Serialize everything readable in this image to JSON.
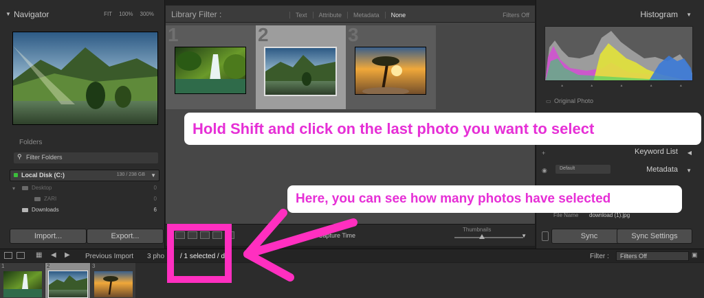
{
  "navigator": {
    "title": "Navigator",
    "zooms": [
      "FIT",
      "100%",
      "300%"
    ]
  },
  "folders": {
    "header_partial": "Folders",
    "filter_placeholder": "Filter Folders",
    "disk_label": "Local Disk (C:)",
    "disk_size": "130 / 238 GB",
    "tree": [
      {
        "label": "Desktop",
        "count": "0"
      },
      {
        "label": "ZARI",
        "count": "0"
      },
      {
        "label": "Downloads",
        "count": "6"
      }
    ],
    "import_label": "Import...",
    "export_label": "Export..."
  },
  "library_filter": {
    "title": "Library Filter :",
    "options": [
      "Text",
      "Attribute",
      "Metadata",
      "None"
    ],
    "active": "None",
    "filters_status": "Filters Off"
  },
  "grid": {
    "cells": [
      {
        "number": "1",
        "selected": false
      },
      {
        "number": "2",
        "selected": true
      },
      {
        "number": "3",
        "selected": false
      }
    ]
  },
  "toolbar": {
    "sort_label": "Capture Time",
    "thumbnails_label": "Thumbnails",
    "thumbnail_size": 0.4
  },
  "histogram": {
    "title": "Histogram",
    "original_photo": "Original Photo"
  },
  "right_panel": {
    "keyword_list": "Keyword List",
    "metadata_title": "Metadata",
    "metadata_preset": "Default",
    "file_name_label": "File Name",
    "file_name_value": "download (1).jpg",
    "sync_label": "Sync",
    "sync_settings_label": "Sync Settings"
  },
  "filmstrip_bar": {
    "source": "Previous Import",
    "photo_count": "3 pho",
    "selected_text": "/ 1 selected / do",
    "filter_label": "Filter :",
    "filter_value": "Filters Off"
  },
  "filmstrip": {
    "cells": [
      {
        "number": "1",
        "selected": false
      },
      {
        "number": "2",
        "selected": true
      },
      {
        "number": "3",
        "selected": false
      }
    ]
  },
  "annotations": {
    "callout_top": "Hold Shift and click on the last photo you want to select",
    "callout_bottom": "Here, you can see how many photos have selected",
    "accent_color": "#ff2fc0",
    "text_color": "#e62fd6"
  }
}
